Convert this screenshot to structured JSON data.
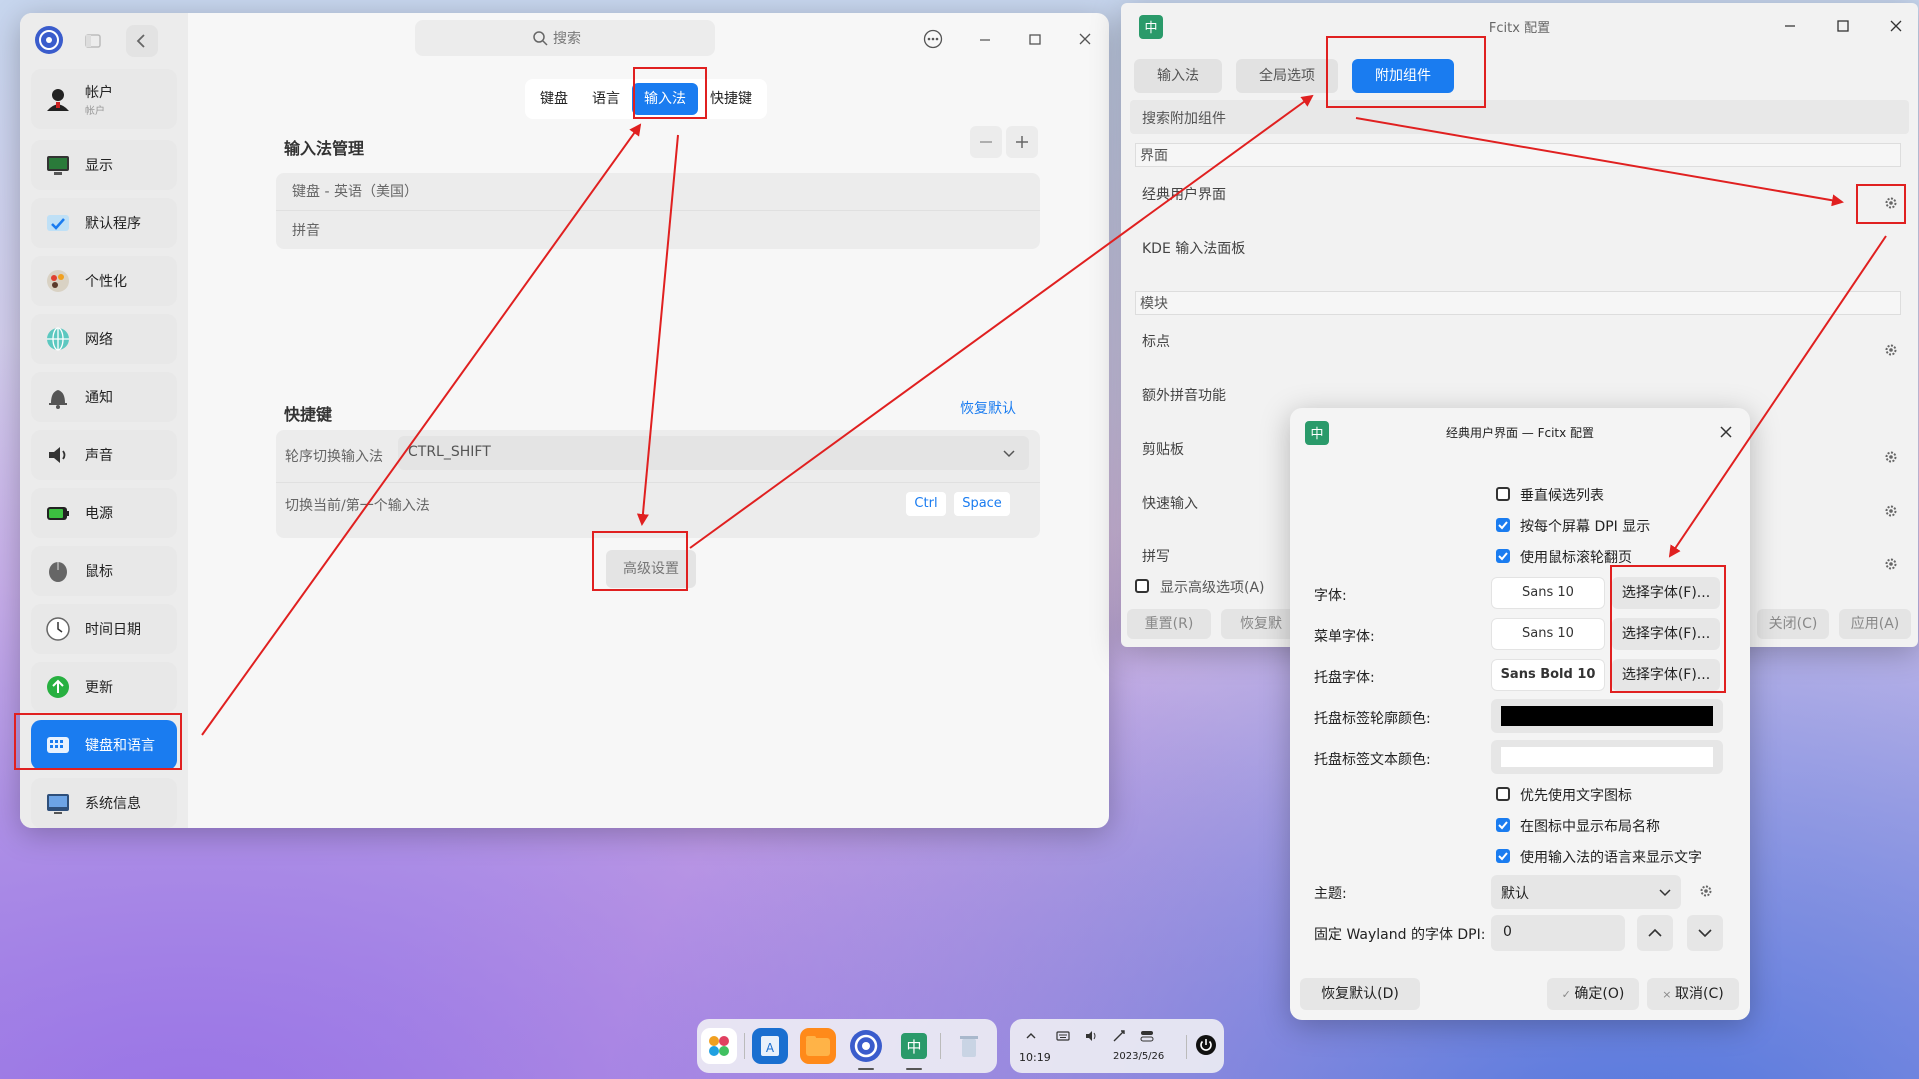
{
  "settings": {
    "search_placeholder": "搜索",
    "sidebar": [
      {
        "label": "帐户",
        "sub": "帐户",
        "icon": "user-icon"
      },
      {
        "label": "显示",
        "icon": "display-icon"
      },
      {
        "label": "默认程序",
        "icon": "default-apps-icon"
      },
      {
        "label": "个性化",
        "icon": "personalization-icon"
      },
      {
        "label": "网络",
        "icon": "network-icon"
      },
      {
        "label": "通知",
        "icon": "bell-icon"
      },
      {
        "label": "声音",
        "icon": "sound-icon"
      },
      {
        "label": "电源",
        "icon": "battery-icon"
      },
      {
        "label": "鼠标",
        "icon": "mouse-icon"
      },
      {
        "label": "时间日期",
        "icon": "clock-icon"
      },
      {
        "label": "更新",
        "icon": "update-icon"
      },
      {
        "label": "键盘和语言",
        "icon": "keyboard-icon",
        "active": true
      },
      {
        "label": "系统信息",
        "icon": "system-info-icon"
      }
    ],
    "tabs": [
      "键盘",
      "语言",
      "输入法",
      "快捷键"
    ],
    "active_tab": "输入法",
    "im_section": {
      "title": "输入法管理",
      "items": [
        "键盘 - 英语（美国）",
        "拼音"
      ]
    },
    "shortcut_section": {
      "title": "快捷键",
      "restore": "恢复默认",
      "switch_label": "轮序切换输入法",
      "switch_value": "CTRL_SHIFT",
      "toggle_label": "切换当前/第一个输入法",
      "key1": "Ctrl",
      "key2": "Space"
    },
    "advanced_button": "高级设置"
  },
  "fcitx": {
    "title": "Fcitx 配置",
    "tabs": [
      "输入法",
      "全局选项",
      "附加组件"
    ],
    "active_tab": "附加组件",
    "search_placeholder": "搜索附加组件",
    "cat_ui": "界面",
    "addon_classic": "经典用户界面",
    "addon_kde": "KDE 输入法面板",
    "cat_module": "模块",
    "addon_punc": "标点",
    "addon_pinyin_extra": "额外拼音功能",
    "addon_clipboard": "剪贴板",
    "addon_quickphrase": "快速输入",
    "addon_spell": "拼写",
    "show_advanced": "显示高级选项(A)",
    "btn_reset": "重置(R)",
    "btn_restore": "恢复默",
    "btn_close": "关闭(C)",
    "btn_apply": "应用(A)"
  },
  "classic": {
    "title": "经典用户界面 — Fcitx 配置",
    "opt_vertical": "垂直候选列表",
    "opt_dpi": "按每个屏幕 DPI 显示",
    "opt_wheel": "使用鼠标滚轮翻页",
    "font_label": "字体:",
    "font_value": "Sans 10",
    "menu_font_label": "菜单字体:",
    "menu_font_value": "Sans 10",
    "tray_font_label": "托盘字体:",
    "tray_font_value": "Sans Bold 10",
    "pick_font": "选择字体(F)...",
    "outline_color_label": "托盘标签轮廓颜色:",
    "text_color_label": "托盘标签文本颜色:",
    "outline_color": "#000000",
    "text_color": "#ffffff",
    "opt_text_icon": "优先使用文字图标",
    "opt_layout_name": "在图标中显示布局名称",
    "opt_lang_text": "使用输入法的语言来显示文字",
    "theme_label": "主题:",
    "theme_value": "默认",
    "wayland_label": "固定 Wayland 的字体 DPI:",
    "wayland_value": "0",
    "btn_restore": "恢复默认(D)",
    "btn_ok": "确定(O)",
    "btn_cancel": "取消(C)"
  },
  "tray": {
    "time": "10:19",
    "date": "2023/5/26"
  },
  "colors": {
    "accent": "#1a7cf0",
    "annotation_red": "#e02020"
  }
}
